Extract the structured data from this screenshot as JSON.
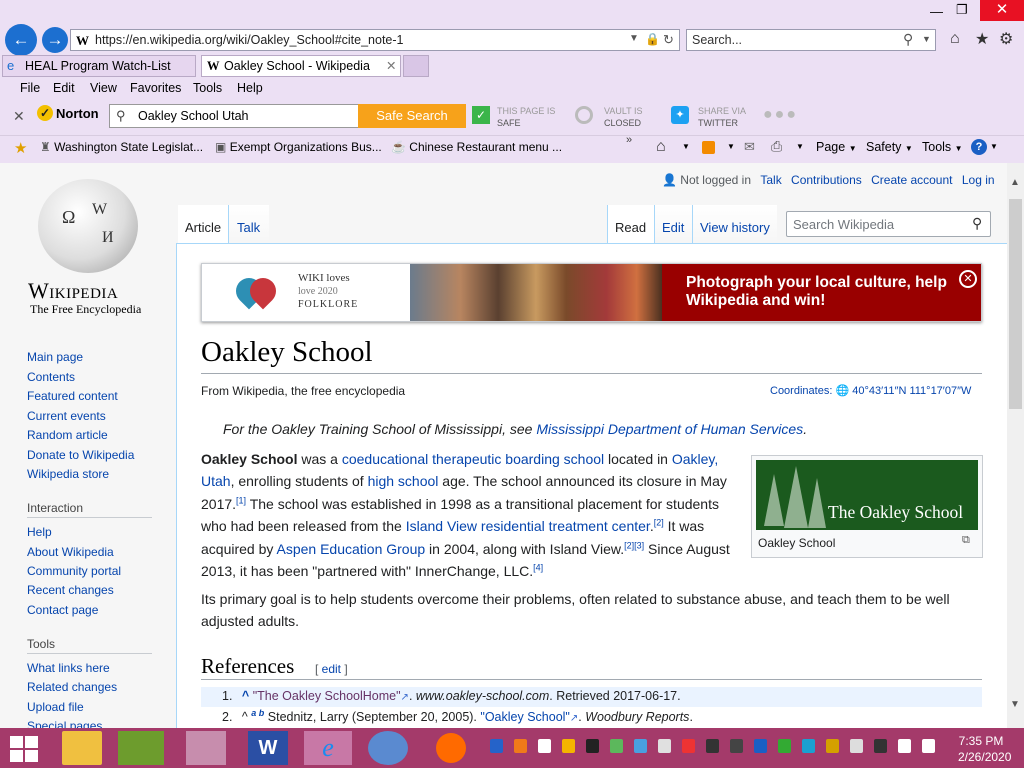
{
  "browser": {
    "url": "https://en.wikipedia.org/wiki/Oakley_School#cite_note-1",
    "search_placeholder": "Search...",
    "tabs": [
      {
        "label": "HEAL Program Watch-List"
      },
      {
        "label": "Oakley School - Wikipedia"
      }
    ],
    "menu": [
      "File",
      "Edit",
      "View",
      "Favorites",
      "Tools",
      "Help"
    ],
    "norton": {
      "brand": "Norton",
      "search_value": "Oakley School Utah",
      "safe_search": "Safe Search",
      "page_safe_1": "THIS PAGE IS",
      "page_safe_2": "SAFE",
      "vault_1": "VAULT IS",
      "vault_2": "CLOSED",
      "share_1": "SHARE VIA",
      "share_2": "TWITTER"
    },
    "favorites": [
      "Washington State Legislat...",
      "Exempt Organizations Bus...",
      "Chinese Restaurant menu ..."
    ],
    "cmd": {
      "page": "Page",
      "safety": "Safety",
      "tools": "Tools"
    }
  },
  "wiki": {
    "logo_title": "Wikipedia",
    "logo_tagline": "The Free Encyclopedia",
    "user": {
      "not_logged": "Not logged in",
      "talk": "Talk",
      "contributions": "Contributions",
      "create": "Create account",
      "login": "Log in"
    },
    "tabs": {
      "article": "Article",
      "talk": "Talk",
      "read": "Read",
      "edit": "Edit",
      "history": "View history"
    },
    "search_placeholder": "Search Wikipedia",
    "banner": {
      "logo_1": "WIKI loves",
      "logo_2": "love 2020",
      "logo_3": "FOLKLORE",
      "text": "Photograph your local culture, help Wikipedia and win!"
    },
    "sidebar": {
      "main": [
        "Main page",
        "Contents",
        "Featured content",
        "Current events",
        "Random article",
        "Donate to Wikipedia",
        "Wikipedia store"
      ],
      "interaction_head": "Interaction",
      "interaction": [
        "Help",
        "About Wikipedia",
        "Community portal",
        "Recent changes",
        "Contact page"
      ],
      "tools_head": "Tools",
      "tools": [
        "What links here",
        "Related changes",
        "Upload file",
        "Special pages"
      ]
    },
    "title": "Oakley School",
    "from": "From Wikipedia, the free encyclopedia",
    "coords_label": "Coordinates:",
    "coords_value": "40°43′11″N 111°17′07″W",
    "hatnote_1": "For the Oakley Training School of Mississippi, see",
    "hatnote_link": "Mississippi Department of Human Services",
    "hatnote_2": ".",
    "p1": {
      "bold": "Oakley School",
      "t1": " was a ",
      "l1": "coeducational therapeutic boarding school",
      "t2": " located in ",
      "l2": "Oakley, Utah",
      "t3": ", enrolling students of ",
      "l3": "high school",
      "t4": " age. The school announced its closure in May 2017.",
      "r1": "[1]",
      "t5": " The school was established in 1998 as a transitional placement for students who had been released from the ",
      "l4": "Island View residential treatment center",
      "t6": ".",
      "r2": "[2]",
      "t7": " It was acquired by ",
      "l5": "Aspen Education Group",
      "t8": " in 2004, along with Island View.",
      "r3": "[2][3]",
      "t9": " Since August 2013, it has been \"partnered with\" InnerChange, LLC.",
      "r4": "[4]"
    },
    "p2": "Its primary goal is to help students overcome their problems, often related to substance abuse, and teach them to be well adjusted adults.",
    "infobox_image_text": "The Oakley School",
    "infobox_caption": "Oakley School",
    "references_head": "References",
    "references_edit": "edit",
    "refs": [
      {
        "num": "1.",
        "caret": "^",
        "link": "\"The Oakley SchoolHome\"",
        "rest_italic": "www.oakley-school.com",
        "rest": ". Retrieved 2017-06-17."
      },
      {
        "num": "2.",
        "caret": "^",
        "ab": "a b",
        "text": " Stednitz, Larry (September 20, 2005). ",
        "link": "\"Oakley School\"",
        "rest_italic": "Woodbury Reports",
        "rest": "."
      }
    ]
  },
  "taskbar": {
    "time": "7:35 PM",
    "date": "2/26/2020"
  }
}
